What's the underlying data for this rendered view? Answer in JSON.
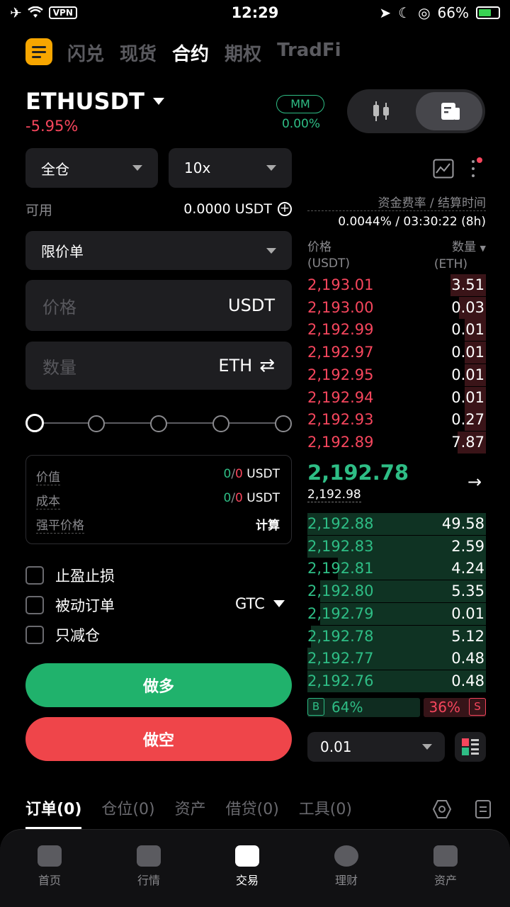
{
  "status": {
    "time": "12:29",
    "vpn": "VPN",
    "battery": "66%"
  },
  "tabs": [
    {
      "label": "闪兑"
    },
    {
      "label": "现货"
    },
    {
      "label": "合约"
    },
    {
      "label": "期权"
    },
    {
      "label": "TradFi"
    }
  ],
  "active_tab": 2,
  "symbol": "ETHUSDT",
  "change": "-5.95%",
  "mm": {
    "label": "MM",
    "value": "0.00%"
  },
  "margin_mode": "全仓",
  "leverage": "10x",
  "available": {
    "label": "可用",
    "value": "0.0000 USDT"
  },
  "order_type": "限价单",
  "price_input": {
    "placeholder": "价格",
    "unit": "USDT"
  },
  "qty_input": {
    "placeholder": "数量",
    "unit": "ETH"
  },
  "info": {
    "value": {
      "label": "价值",
      "green": "0",
      "sep": "/",
      "red": "0",
      "unit": "USDT"
    },
    "cost": {
      "label": "成本",
      "green": "0",
      "sep": "/",
      "red": "0",
      "unit": "USDT"
    },
    "liq": {
      "label": "强平价格",
      "action": "计算"
    }
  },
  "checks": {
    "tpsl": "止盈止损",
    "post_only": "被动订单",
    "reduce_only": "只减仓",
    "tif": "GTC"
  },
  "buttons": {
    "long": "做多",
    "short": "做空"
  },
  "funding": {
    "label": "资金费率 / 结算时间",
    "value": "0.0044% / 03:30:22 (8h)"
  },
  "orderbook": {
    "price_header": "价格",
    "price_unit": "(USDT)",
    "qty_header": "数量",
    "qty_unit": "(ETH)",
    "asks": [
      {
        "price": "2,193.01",
        "qty": "3.51",
        "depth": 0.2
      },
      {
        "price": "2,193.00",
        "qty": "0.03",
        "depth": 0.15
      },
      {
        "price": "2,192.99",
        "qty": "0.01",
        "depth": 0.12
      },
      {
        "price": "2,192.97",
        "qty": "0.01",
        "depth": 0.12
      },
      {
        "price": "2,192.95",
        "qty": "0.01",
        "depth": 0.12
      },
      {
        "price": "2,192.94",
        "qty": "0.01",
        "depth": 0.12
      },
      {
        "price": "2,192.93",
        "qty": "0.27",
        "depth": 0.12
      },
      {
        "price": "2,192.89",
        "qty": "7.87",
        "depth": 0.16
      }
    ],
    "last_price": "2,192.78",
    "mark_price": "2,192.98",
    "bids": [
      {
        "price": "2,192.88",
        "qty": "49.58",
        "depth": 1.0
      },
      {
        "price": "2,192.83",
        "qty": "2.59",
        "depth": 1.0
      },
      {
        "price": "2,192.81",
        "qty": "4.24",
        "depth": 0.83
      },
      {
        "price": "2,192.80",
        "qty": "5.35",
        "depth": 0.93
      },
      {
        "price": "2,192.79",
        "qty": "0.01",
        "depth": 0.93
      },
      {
        "price": "2,192.78",
        "qty": "5.12",
        "depth": 0.98
      },
      {
        "price": "2,192.77",
        "qty": "0.48",
        "depth": 1.0
      },
      {
        "price": "2,192.76",
        "qty": "0.48",
        "depth": 1.0
      }
    ],
    "buy_label": "B",
    "buy_pct": "64%",
    "sell_pct": "36%",
    "sell_label": "S",
    "buy_ratio": 0.64,
    "precision": "0.01"
  },
  "bottom_tabs": [
    {
      "label": "订单(0)"
    },
    {
      "label": "仓位(0)"
    },
    {
      "label": "资产"
    },
    {
      "label": "借贷(0)"
    },
    {
      "label": "工具(0)"
    }
  ],
  "nav": [
    {
      "label": "首页"
    },
    {
      "label": "行情"
    },
    {
      "label": "交易"
    },
    {
      "label": "理财"
    },
    {
      "label": "资产"
    }
  ],
  "colors": {
    "green": "#2ebd85",
    "red": "#f6465d",
    "brand": "#f7a600"
  }
}
